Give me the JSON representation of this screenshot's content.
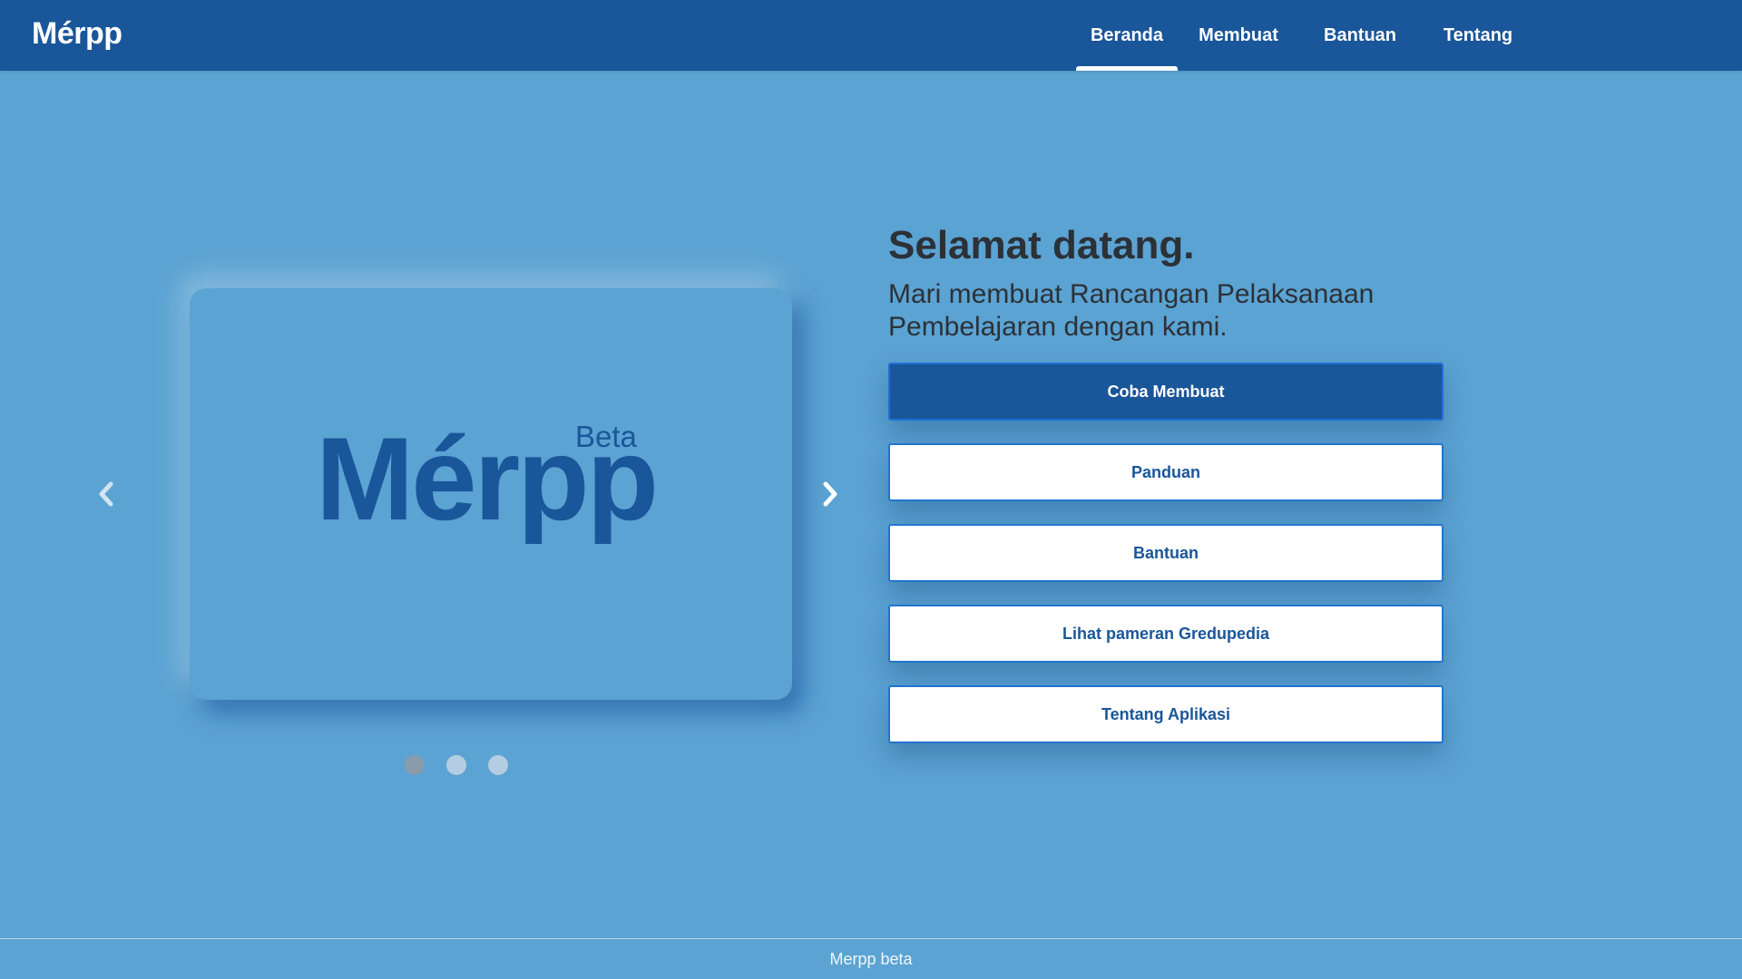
{
  "header": {
    "brand": "Mérpp",
    "nav": [
      {
        "label": "Beranda",
        "active": true
      },
      {
        "label": "Membuat",
        "active": false
      },
      {
        "label": "Bantuan",
        "active": false
      },
      {
        "label": "Tentang",
        "active": false
      }
    ]
  },
  "carousel": {
    "logo_text": "Mérpp",
    "logo_badge": "Beta",
    "prev_icon": "chevron-left-icon",
    "next_icon": "chevron-right-icon",
    "slide_count": 3,
    "active_slide": 1
  },
  "welcome": {
    "title": "Selamat datang.",
    "subtitle": "Mari membuat Rancangan Pelaksanaan Pembelajaran dengan kami."
  },
  "actions": {
    "primary": "Coba Membuat",
    "guide": "Panduan",
    "help": "Bantuan",
    "exhibit": "Lihat pameran Gredupedia",
    "about": "Tentang Aplikasi"
  },
  "footer": {
    "text": "Merpp beta"
  },
  "colors": {
    "header_bg": "#1a569a",
    "page_bg": "#5ba3d2",
    "primary": "#1a569a",
    "text_dark": "#2c3138"
  }
}
